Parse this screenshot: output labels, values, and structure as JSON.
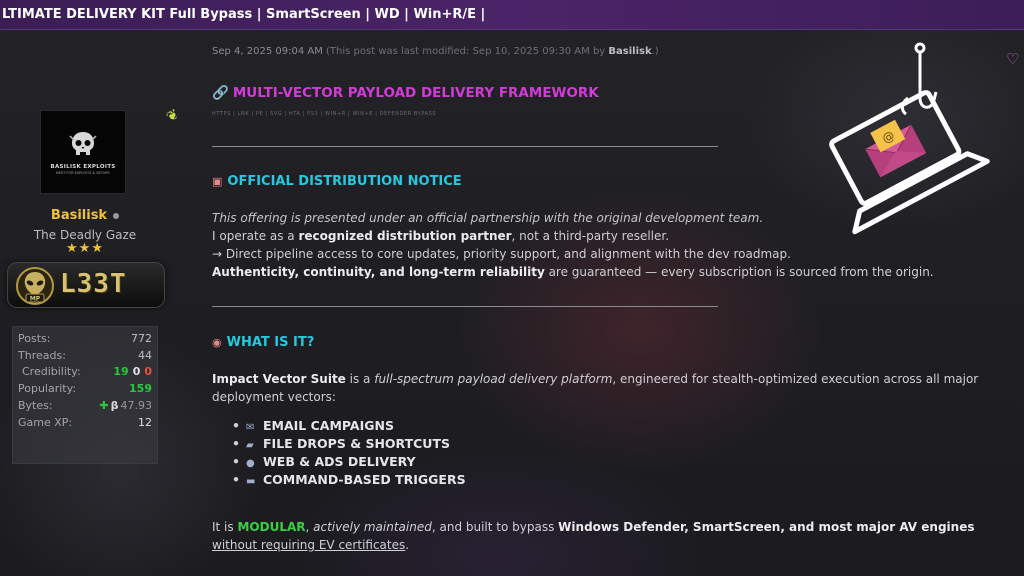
{
  "window": {
    "title": "LTIMATE DELIVERY KIT Full Bypass | SmartScreen | WD | Win+R/E |"
  },
  "user": {
    "avatar_brand": "BASILISK EXPLOITS",
    "avatar_sub": "BEST FOR EXPLOITS & SETUPS",
    "name": "Basilisk",
    "title": "The Deadly Gaze",
    "stars": "★★★",
    "rank_badge_text": "L33T",
    "rank_badge_sub": "MP",
    "stats": {
      "posts_label": "Posts:",
      "posts_value": "772",
      "threads_label": "Threads:",
      "threads_value": "44",
      "credibility_label": "Credibility:",
      "credibility_pos": "19",
      "credibility_neu": "0",
      "credibility_neg": "0",
      "popularity_label": "Popularity:",
      "popularity_value": "159",
      "bytes_label": "Bytes:",
      "bytes_symbol": "β",
      "bytes_value": "47.93",
      "gamexp_label": "Game XP:",
      "gamexp_value": "12"
    }
  },
  "post": {
    "date": "Sep 4, 2025 09:04 AM",
    "edit_prefix": "(This post was last modified: Sep 10, 2025 09:30 AM by",
    "edit_user": "Basilisk",
    "edit_suffix": ".)",
    "heading": "MULTI-VECTOR PAYLOAD DELIVERY FRAMEWORK",
    "subtags": "HTTPS | LNK | PE | SVG | HTA | PS1 | WIN+R | WIN+E | DEFENDER BYPASS",
    "dist_heading": "OFFICIAL DISTRIBUTION NOTICE",
    "dist_line1": "This offering is presented under an official partnership with the original development team.",
    "dist_line2_pre": "I operate as a ",
    "dist_line2_bold": "recognized distribution partner",
    "dist_line2_post": ", not a third-party reseller.",
    "dist_line3": "→ Direct pipeline access to core updates, priority support, and alignment with the dev roadmap.",
    "dist_line4_bold": "Authenticity, continuity, and long-term reliability",
    "dist_line4_post": " are guaranteed — every subscription is sourced from the origin.",
    "what_heading": "WHAT IS IT?",
    "what_line1_b": "Impact Vector Suite",
    "what_line1_mid": " is a ",
    "what_line1_i": "full-spectrum payload delivery platform",
    "what_line1_post": ", engineered for stealth-optimized execution across all major",
    "what_line2": "deployment vectors:",
    "bullets": [
      "EMAIL CAMPAIGNS",
      "FILE DROPS & SHORTCUTS",
      "WEB & ADS DELIVERY",
      "COMMAND-BASED TRIGGERS"
    ],
    "closing_pre": "It is ",
    "closing_mod": "MODULAR",
    "closing_comma": ", ",
    "closing_i": "actively maintained",
    "closing_mid": ", and built to bypass ",
    "closing_b": "Windows Defender, SmartScreen, and most major AV engines",
    "closing_line2": "without requiring EV certificates",
    "closing_end": "."
  },
  "colors": {
    "title_bar": "#4a2468",
    "heading_magenta": "#d13bd6",
    "section_cyan": "#27c8e0",
    "username_gold": "#f0c239",
    "modular_green": "#36d23f"
  },
  "icons": {
    "heart": "heart-icon",
    "leaf": "leaf-icon",
    "phishing": "laptop-email-phishing-icon"
  }
}
